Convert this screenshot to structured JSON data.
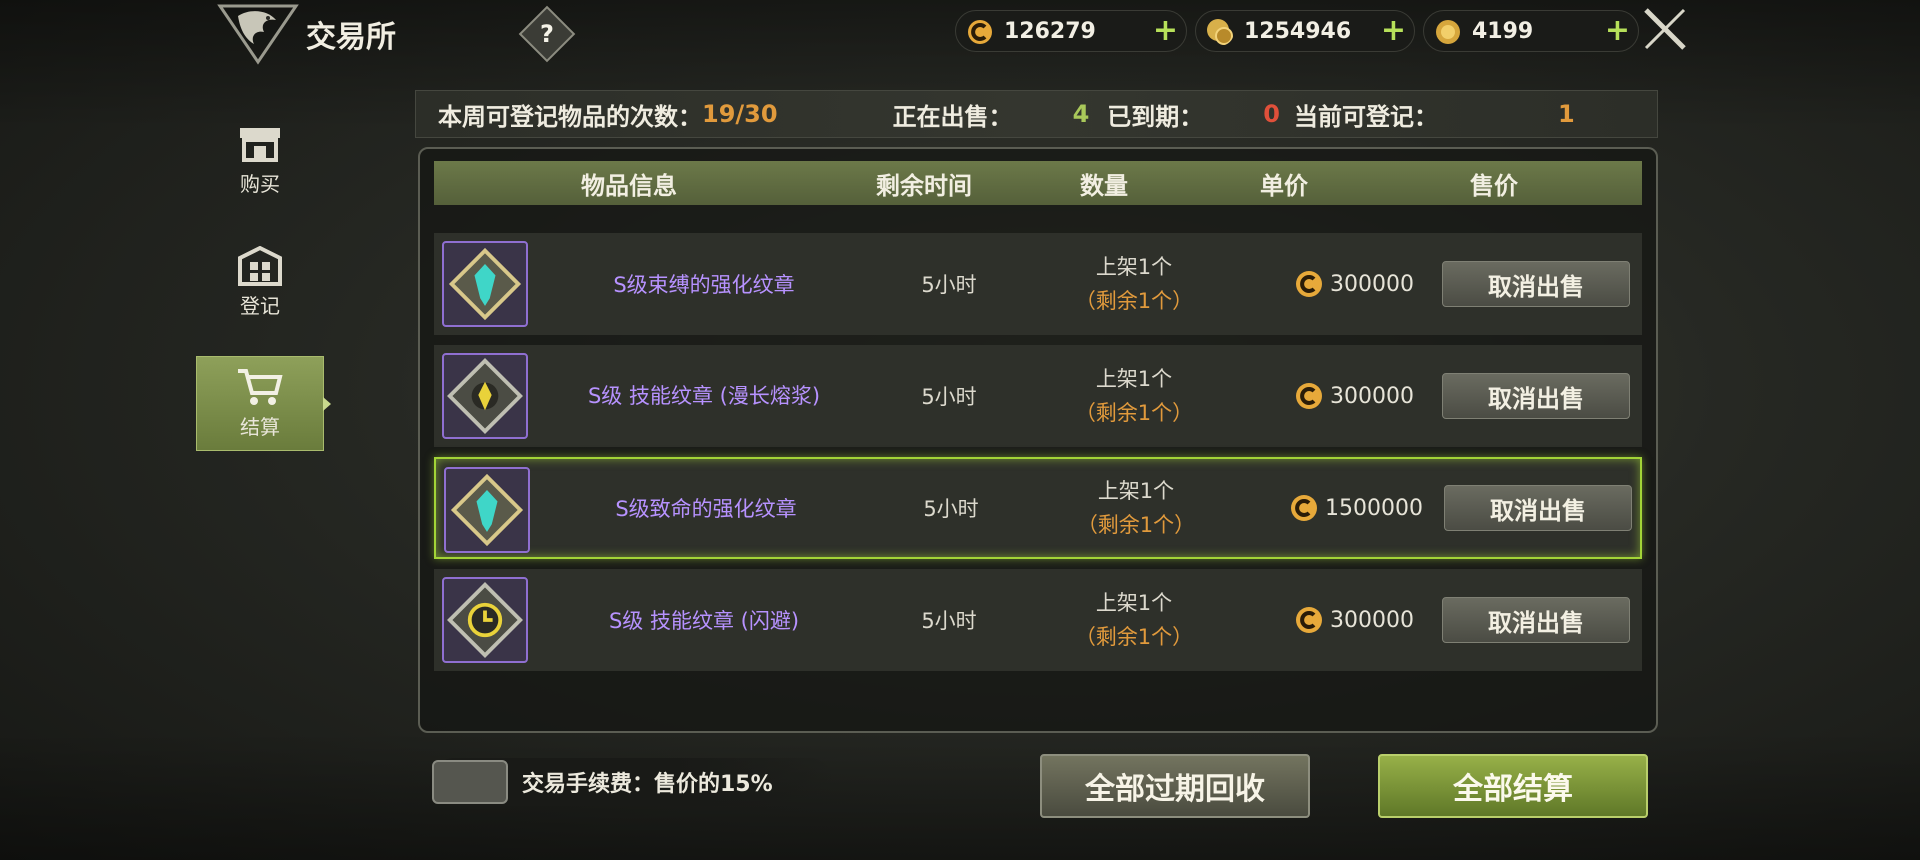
{
  "header": {
    "title": "交易所",
    "help_label": "?"
  },
  "currencies": [
    {
      "icon": "gold-coin-c-icon",
      "value": "126279"
    },
    {
      "icon": "coin-stack-icon",
      "value": "1254946"
    },
    {
      "icon": "gold-coin-icon",
      "value": "4199"
    }
  ],
  "sidebar": {
    "items": [
      {
        "label": "购买",
        "icon": "shop-icon",
        "active": false
      },
      {
        "label": "登记",
        "icon": "register-icon",
        "active": false
      },
      {
        "label": "结算",
        "icon": "cart-icon",
        "active": true
      }
    ]
  },
  "stats": {
    "weekly_label": "本周可登记物品的次数：",
    "weekly_value": "19/30",
    "selling_label": "正在出售：",
    "selling_value": "4",
    "expired_label": "已到期：",
    "expired_value": "0",
    "available_label": "当前可登记：",
    "available_value": "1"
  },
  "table": {
    "headers": [
      "物品信息",
      "剩余时间",
      "数量",
      "单价",
      "售价"
    ],
    "rows": [
      {
        "name": "S级束缚的强化纹章",
        "time": "5小时",
        "qty": "上架1个",
        "remain": "（剩余1个）",
        "price": "300000",
        "action": "取消出售",
        "selected": false
      },
      {
        "name": "S级 技能纹章 (漫长熔浆)",
        "time": "5小时",
        "qty": "上架1个",
        "remain": "（剩余1个）",
        "price": "300000",
        "action": "取消出售",
        "selected": false
      },
      {
        "name": "S级致命的强化纹章",
        "time": "5小时",
        "qty": "上架1个",
        "remain": "（剩余1个）",
        "price": "1500000",
        "action": "取消出售",
        "selected": true
      },
      {
        "name": "S级 技能纹章 (闪避)",
        "time": "5小时",
        "qty": "上架1个",
        "remain": "（剩余1个）",
        "price": "300000",
        "action": "取消出售",
        "selected": false
      }
    ]
  },
  "footer": {
    "fee_text": "交易手续费：售价的15%",
    "recycle_label": "全部过期回收",
    "settle_label": "全部结算"
  },
  "colors": {
    "accent_green": "#a2d437",
    "orange": "#e19a3c",
    "red": "#e0503a",
    "purple_item": "#b792ff"
  }
}
